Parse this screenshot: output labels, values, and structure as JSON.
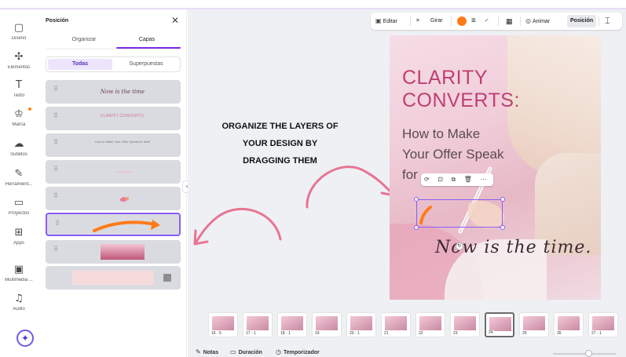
{
  "rail": {
    "items": [
      {
        "icon": "layout-icon",
        "glyph": "▢",
        "label": "Diseño"
      },
      {
        "icon": "elements-icon",
        "glyph": "✣",
        "label": "Elementos"
      },
      {
        "icon": "text-icon",
        "glyph": "T",
        "label": "Texto"
      },
      {
        "icon": "brand-icon",
        "glyph": "♔",
        "label": "Marca"
      },
      {
        "icon": "upload-icon",
        "glyph": "☁",
        "label": "Subidos"
      },
      {
        "icon": "tools-icon",
        "glyph": "✎",
        "label": "Herramient..."
      },
      {
        "icon": "folder-icon",
        "glyph": "▭",
        "label": "Proyectos"
      },
      {
        "icon": "apps-icon",
        "glyph": "⊞",
        "label": "Apps"
      },
      {
        "icon": "media-icon",
        "glyph": "▣",
        "label": "Multimedia ..."
      },
      {
        "icon": "audio-icon",
        "glyph": "♫",
        "label": "Audio"
      }
    ],
    "magic_glyph": "✦",
    "accent": "#7d2ae8"
  },
  "panel": {
    "title": "Posición",
    "close_glyph": "✕",
    "tabs": [
      "Organizar",
      "Capas"
    ],
    "active_tab": "Capas",
    "filters": [
      "Todas",
      "Superpuestas"
    ],
    "active_filter": "Todas",
    "grip_glyph": "⠿",
    "layers": [
      {
        "name": "script-text-layer",
        "text": "Now is the time"
      },
      {
        "name": "title-layer",
        "text": "CLARITY CONVERTS:"
      },
      {
        "name": "subtitle-layer",
        "text": "How to Make Your Offer Speak for itself"
      },
      {
        "name": "element-layer-4",
        "text": ""
      },
      {
        "name": "element-layer-5",
        "text": ""
      },
      {
        "name": "arrow-layer",
        "text": ""
      },
      {
        "name": "photo-layer",
        "text": ""
      },
      {
        "name": "background-layer",
        "text": ""
      }
    ],
    "selected_layer_index": 5,
    "collapse_glyph": "‹"
  },
  "toolbar": {
    "edit": "Editar",
    "crop_glyph": "⌗",
    "rotate": "Girar",
    "color": "#ff7a1a",
    "lines_glyph": "≡",
    "curve_glyph": "◜",
    "transparency_glyph": "▦",
    "animate": "Animar",
    "position": "Posición",
    "paint_glyph": "⌶"
  },
  "annotation": {
    "lines": [
      "ORGANIZE THE LAYERS OF",
      "YOUR DESIGN BY",
      "DRAGGING THEM"
    ],
    "arrow_color": "#e77592"
  },
  "design": {
    "title_lines": [
      "CLARITY",
      "CONVERTS:"
    ],
    "subtitle_lines": [
      "How to Make",
      "Your Offer Speak",
      "for"
    ],
    "script": "Now is the time.",
    "float_bar": "⟳ ⊡ ⧉ 🗑 ⋯",
    "title_color": "#bf3f72"
  },
  "filmstrip": {
    "pages": [
      "16 - 5",
      "17 - 1",
      "18 - 1",
      "19",
      "20 - 1",
      "21",
      "22",
      "23",
      "24",
      "25",
      "26",
      "27 - 1"
    ],
    "active_index": 8
  },
  "bottom": {
    "notes": "Notas",
    "duration": "Duración",
    "timer": "Temporizador"
  }
}
